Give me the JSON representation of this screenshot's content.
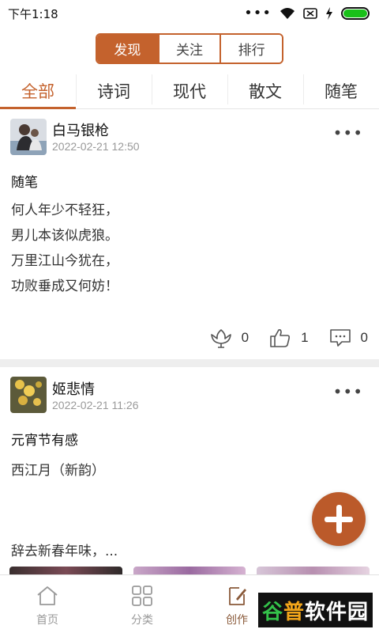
{
  "status_bar": {
    "time": "下午1:18",
    "icons": [
      "more-dots-icon",
      "wifi-icon",
      "sim-off-icon",
      "charging-icon",
      "battery-icon"
    ]
  },
  "top_segments": [
    {
      "label": "发现",
      "active": true
    },
    {
      "label": "关注",
      "active": false
    },
    {
      "label": "排行",
      "active": false
    }
  ],
  "category_tabs": [
    {
      "label": "全部",
      "active": true
    },
    {
      "label": "诗词",
      "active": false
    },
    {
      "label": "现代",
      "active": false
    },
    {
      "label": "散文",
      "active": false
    },
    {
      "label": "随笔",
      "active": false
    }
  ],
  "posts": [
    {
      "username": "白马银枪",
      "timestamp": "2022-02-21 12:50",
      "title": "随笔",
      "lines": [
        "何人年少不轻狂，",
        "男儿本该似虎狼。",
        "万里江山今犹在，",
        "功败垂成又何妨！"
      ],
      "flowers": "0",
      "likes": "1",
      "comments": "0"
    },
    {
      "username": "姬悲情",
      "timestamp": "2022-02-21 11:26",
      "title": "元宵节有感",
      "subtitle": "西江月（新韵）",
      "excerpt": "辞去新春年味，..."
    }
  ],
  "bottom_nav": [
    {
      "label": "首页",
      "icon": "home-icon",
      "active": false
    },
    {
      "label": "分类",
      "icon": "grid-icon",
      "active": false
    },
    {
      "label": "创作",
      "icon": "compose-icon",
      "active": true
    }
  ],
  "watermark": {
    "part1": "谷",
    "part2": "普",
    "part3": "软件园"
  },
  "colors": {
    "accent": "#c4622d",
    "fab": "#bb5a2a"
  }
}
